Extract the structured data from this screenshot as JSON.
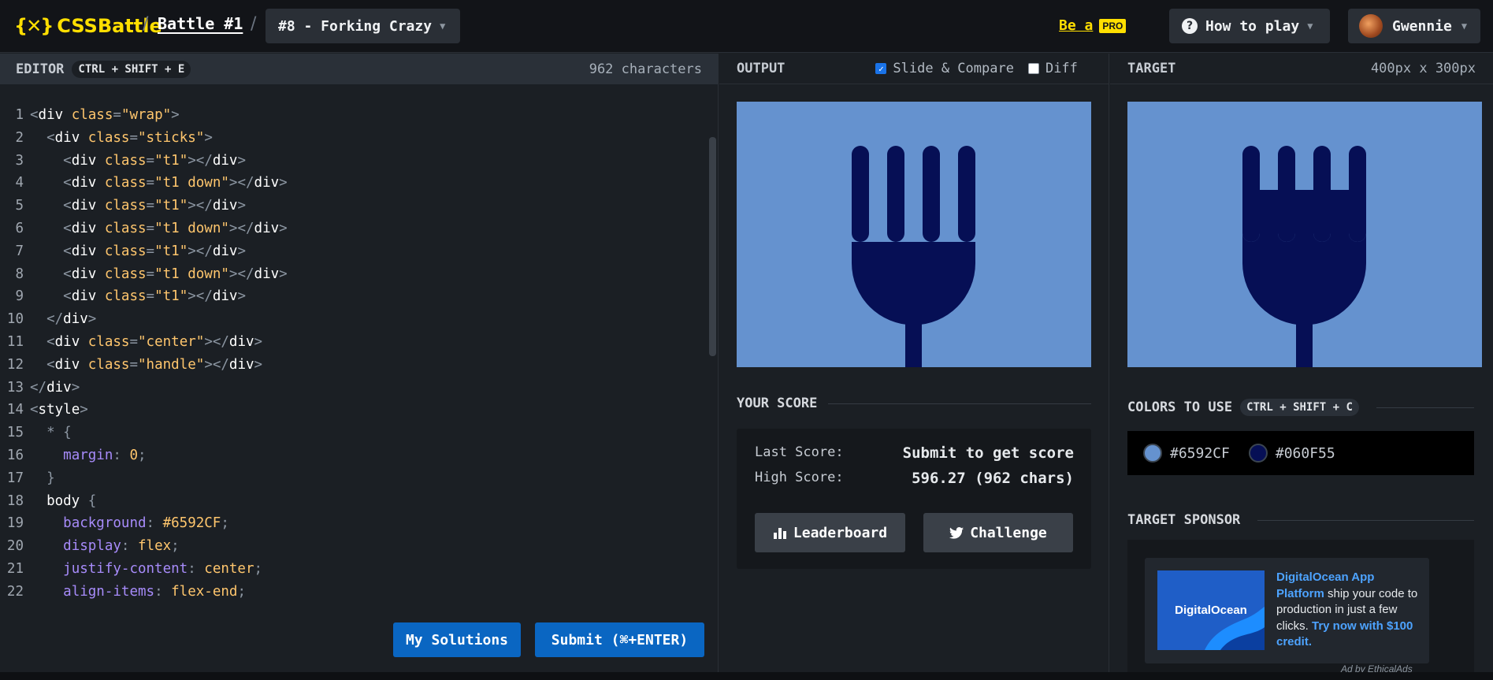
{
  "header": {
    "logo_text": "CSSBattle",
    "logo_mark": "{✕}",
    "separator": "/",
    "battle_label": "Battle #1",
    "challenge_label": "#8 - Forking Crazy",
    "be_a_label": "Be a",
    "pro_badge": "PRO",
    "how_to_play_label": "How to play",
    "user_name": "Gwennie"
  },
  "editor": {
    "title": "EDITOR",
    "shortcut": "CTRL + SHIFT + E",
    "char_count": "962 characters",
    "line_numbers": [
      "1",
      "2",
      "3",
      "4",
      "5",
      "6",
      "7",
      "8",
      "9",
      "10",
      "11",
      "12",
      "13",
      "14",
      "15",
      "16",
      "17",
      "18",
      "19",
      "20",
      "21",
      "22"
    ],
    "my_solutions_label": "My Solutions",
    "submit_label": "Submit (⌘+ENTER)"
  },
  "output": {
    "title": "OUTPUT",
    "slide_compare_label": "Slide & Compare",
    "slide_compare_checked": true,
    "diff_label": "Diff",
    "diff_checked": false,
    "your_score_title": "YOUR SCORE",
    "last_score_label": "Last Score:",
    "last_score_value": "Submit to get score",
    "high_score_label": "High Score:",
    "high_score_value": "596.27 (962 chars)",
    "leaderboard_label": "Leaderboard",
    "challenge_label": "Challenge"
  },
  "target": {
    "title": "TARGET",
    "size_label": "400px x 300px",
    "colors_title": "COLORS TO USE",
    "colors_shortcut": "CTRL + SHIFT + C",
    "colors": [
      {
        "hex": "#6592CF",
        "label": "#6592CF"
      },
      {
        "hex": "#060F55",
        "label": "#060F55"
      }
    ],
    "sponsor_title": "TARGET SPONSOR",
    "ad_image_text": "DigitalOcean",
    "ad_title": "DigitalOcean App Platform",
    "ad_body": " ship your code to production in just a few clicks. ",
    "ad_cta": "Try now with $100 credit.",
    "ad_by": "Ad by EthicalAds"
  },
  "theme": {
    "accent_yellow": "#ffdf00",
    "button_blue": "#0a66c2",
    "bg_color": "#6592CF",
    "fork_color": "#060F55"
  }
}
